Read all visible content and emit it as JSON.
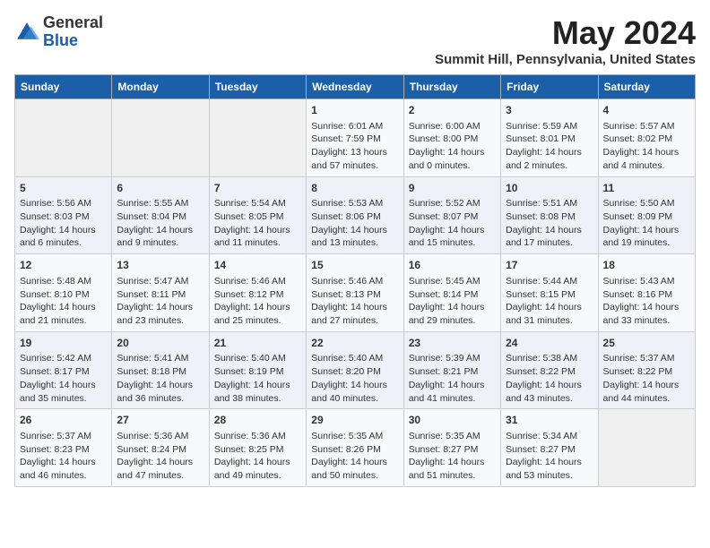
{
  "logo": {
    "general": "General",
    "blue": "Blue"
  },
  "header": {
    "title": "May 2024",
    "subtitle": "Summit Hill, Pennsylvania, United States"
  },
  "weekdays": [
    "Sunday",
    "Monday",
    "Tuesday",
    "Wednesday",
    "Thursday",
    "Friday",
    "Saturday"
  ],
  "weeks": [
    [
      {
        "day": "",
        "info": ""
      },
      {
        "day": "",
        "info": ""
      },
      {
        "day": "",
        "info": ""
      },
      {
        "day": "1",
        "info": "Sunrise: 6:01 AM\nSunset: 7:59 PM\nDaylight: 13 hours\nand 57 minutes."
      },
      {
        "day": "2",
        "info": "Sunrise: 6:00 AM\nSunset: 8:00 PM\nDaylight: 14 hours\nand 0 minutes."
      },
      {
        "day": "3",
        "info": "Sunrise: 5:59 AM\nSunset: 8:01 PM\nDaylight: 14 hours\nand 2 minutes."
      },
      {
        "day": "4",
        "info": "Sunrise: 5:57 AM\nSunset: 8:02 PM\nDaylight: 14 hours\nand 4 minutes."
      }
    ],
    [
      {
        "day": "5",
        "info": "Sunrise: 5:56 AM\nSunset: 8:03 PM\nDaylight: 14 hours\nand 6 minutes."
      },
      {
        "day": "6",
        "info": "Sunrise: 5:55 AM\nSunset: 8:04 PM\nDaylight: 14 hours\nand 9 minutes."
      },
      {
        "day": "7",
        "info": "Sunrise: 5:54 AM\nSunset: 8:05 PM\nDaylight: 14 hours\nand 11 minutes."
      },
      {
        "day": "8",
        "info": "Sunrise: 5:53 AM\nSunset: 8:06 PM\nDaylight: 14 hours\nand 13 minutes."
      },
      {
        "day": "9",
        "info": "Sunrise: 5:52 AM\nSunset: 8:07 PM\nDaylight: 14 hours\nand 15 minutes."
      },
      {
        "day": "10",
        "info": "Sunrise: 5:51 AM\nSunset: 8:08 PM\nDaylight: 14 hours\nand 17 minutes."
      },
      {
        "day": "11",
        "info": "Sunrise: 5:50 AM\nSunset: 8:09 PM\nDaylight: 14 hours\nand 19 minutes."
      }
    ],
    [
      {
        "day": "12",
        "info": "Sunrise: 5:48 AM\nSunset: 8:10 PM\nDaylight: 14 hours\nand 21 minutes."
      },
      {
        "day": "13",
        "info": "Sunrise: 5:47 AM\nSunset: 8:11 PM\nDaylight: 14 hours\nand 23 minutes."
      },
      {
        "day": "14",
        "info": "Sunrise: 5:46 AM\nSunset: 8:12 PM\nDaylight: 14 hours\nand 25 minutes."
      },
      {
        "day": "15",
        "info": "Sunrise: 5:46 AM\nSunset: 8:13 PM\nDaylight: 14 hours\nand 27 minutes."
      },
      {
        "day": "16",
        "info": "Sunrise: 5:45 AM\nSunset: 8:14 PM\nDaylight: 14 hours\nand 29 minutes."
      },
      {
        "day": "17",
        "info": "Sunrise: 5:44 AM\nSunset: 8:15 PM\nDaylight: 14 hours\nand 31 minutes."
      },
      {
        "day": "18",
        "info": "Sunrise: 5:43 AM\nSunset: 8:16 PM\nDaylight: 14 hours\nand 33 minutes."
      }
    ],
    [
      {
        "day": "19",
        "info": "Sunrise: 5:42 AM\nSunset: 8:17 PM\nDaylight: 14 hours\nand 35 minutes."
      },
      {
        "day": "20",
        "info": "Sunrise: 5:41 AM\nSunset: 8:18 PM\nDaylight: 14 hours\nand 36 minutes."
      },
      {
        "day": "21",
        "info": "Sunrise: 5:40 AM\nSunset: 8:19 PM\nDaylight: 14 hours\nand 38 minutes."
      },
      {
        "day": "22",
        "info": "Sunrise: 5:40 AM\nSunset: 8:20 PM\nDaylight: 14 hours\nand 40 minutes."
      },
      {
        "day": "23",
        "info": "Sunrise: 5:39 AM\nSunset: 8:21 PM\nDaylight: 14 hours\nand 41 minutes."
      },
      {
        "day": "24",
        "info": "Sunrise: 5:38 AM\nSunset: 8:22 PM\nDaylight: 14 hours\nand 43 minutes."
      },
      {
        "day": "25",
        "info": "Sunrise: 5:37 AM\nSunset: 8:22 PM\nDaylight: 14 hours\nand 44 minutes."
      }
    ],
    [
      {
        "day": "26",
        "info": "Sunrise: 5:37 AM\nSunset: 8:23 PM\nDaylight: 14 hours\nand 46 minutes."
      },
      {
        "day": "27",
        "info": "Sunrise: 5:36 AM\nSunset: 8:24 PM\nDaylight: 14 hours\nand 47 minutes."
      },
      {
        "day": "28",
        "info": "Sunrise: 5:36 AM\nSunset: 8:25 PM\nDaylight: 14 hours\nand 49 minutes."
      },
      {
        "day": "29",
        "info": "Sunrise: 5:35 AM\nSunset: 8:26 PM\nDaylight: 14 hours\nand 50 minutes."
      },
      {
        "day": "30",
        "info": "Sunrise: 5:35 AM\nSunset: 8:27 PM\nDaylight: 14 hours\nand 51 minutes."
      },
      {
        "day": "31",
        "info": "Sunrise: 5:34 AM\nSunset: 8:27 PM\nDaylight: 14 hours\nand 53 minutes."
      },
      {
        "day": "",
        "info": ""
      }
    ]
  ]
}
